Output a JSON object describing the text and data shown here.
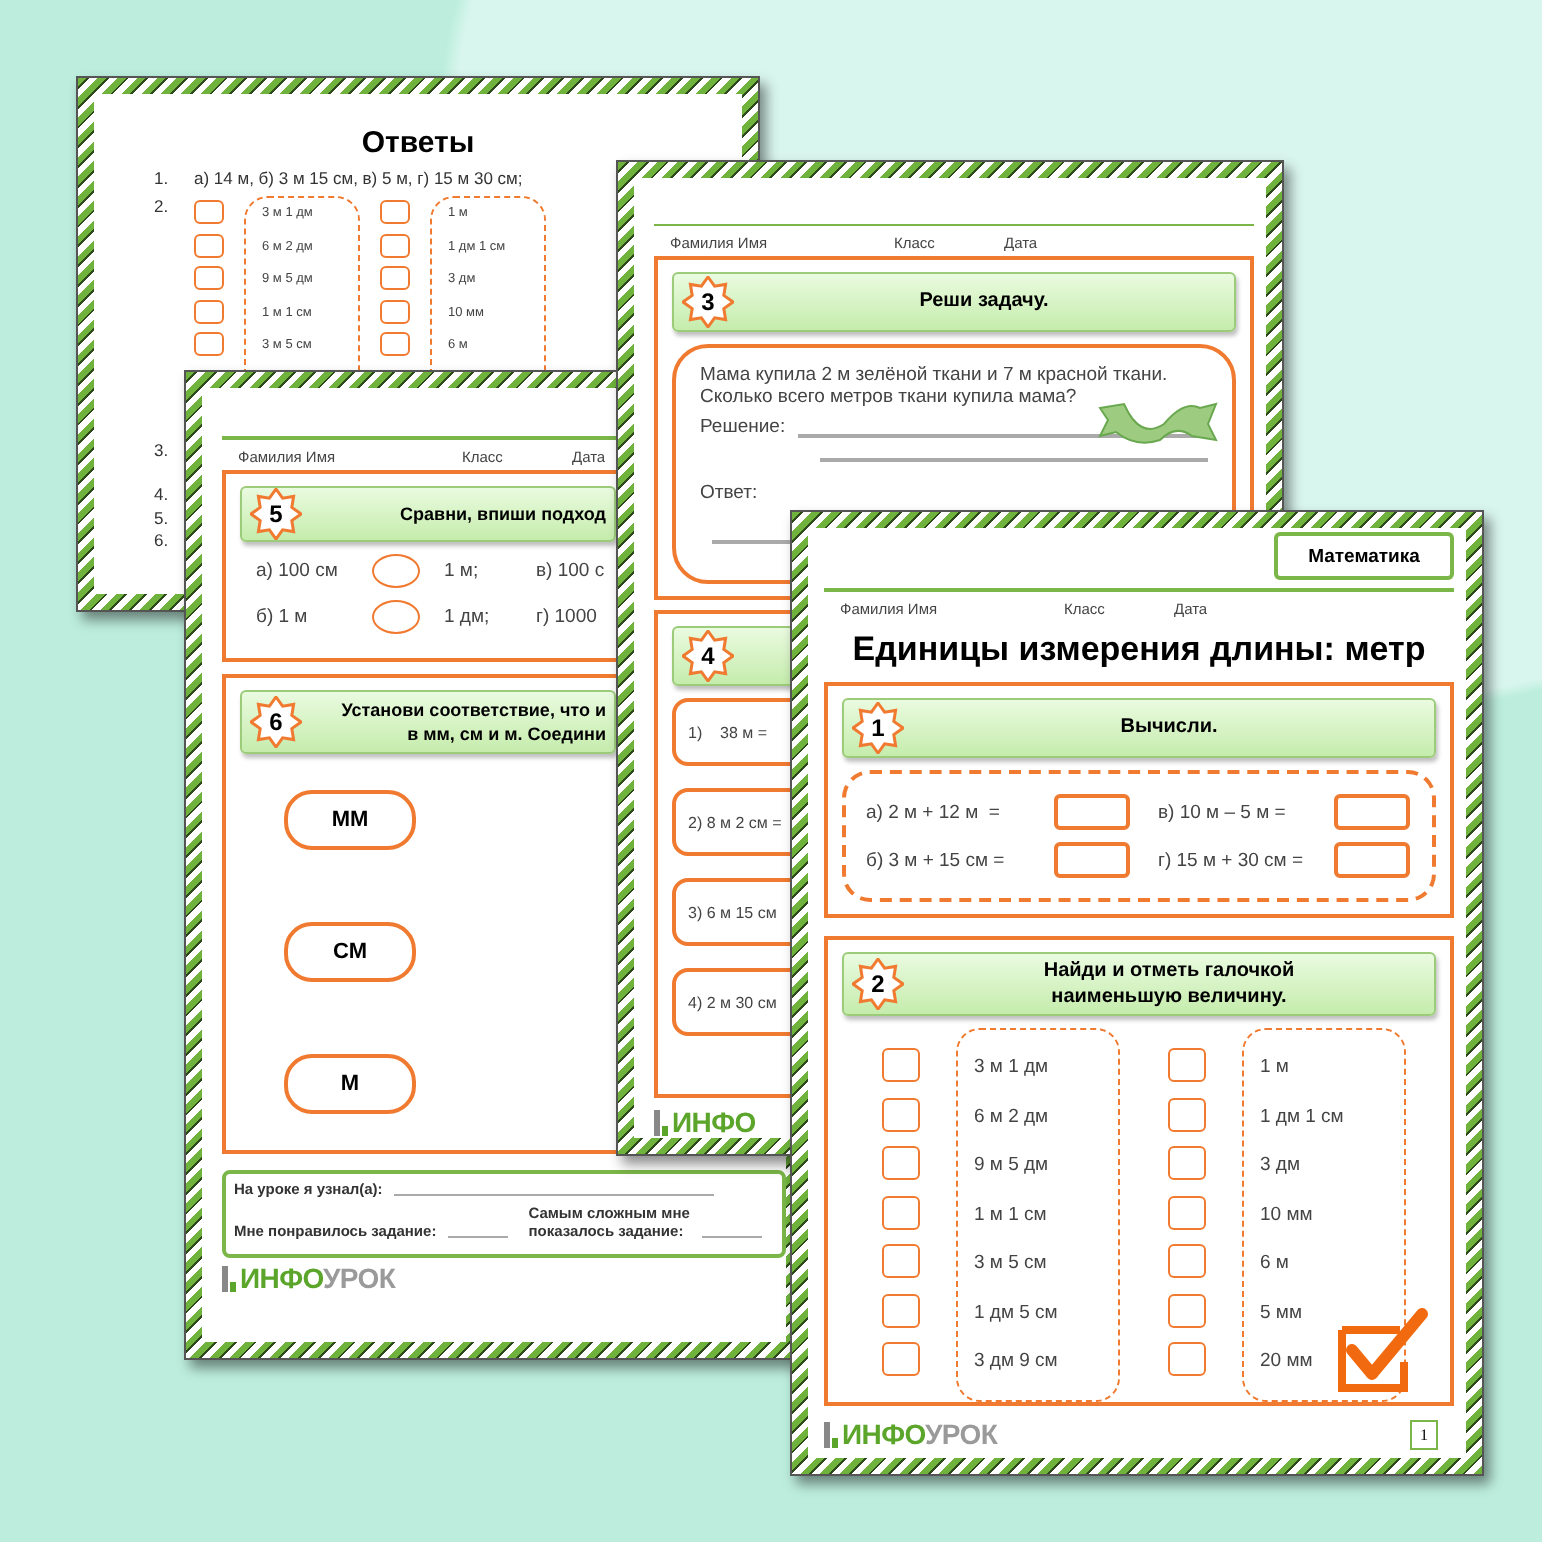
{
  "answers_page": {
    "title": "Ответы",
    "items": [
      {
        "kind": "text",
        "number": "1.",
        "text": "а) 14 м, б) 3 м 15 см, в) 5 м, г) 15 м 30 см;"
      },
      {
        "kind": "choice",
        "number": "2.",
        "lists": [
          [
            {
              "text": "3 м 1 дм",
              "checked": false
            },
            {
              "text": "6 м 2 дм",
              "checked": false
            },
            {
              "text": "9 м 5 дм",
              "checked": false
            },
            {
              "text": "1 м 1 см",
              "checked": false
            },
            {
              "text": "3 м 5 см",
              "checked": false
            }
          ],
          [
            {
              "text": "1 м",
              "checked": false
            },
            {
              "text": "1 дм 1 см",
              "checked": false
            },
            {
              "text": "3 дм",
              "checked": false
            },
            {
              "text": "10 мм",
              "checked": false
            },
            {
              "text": "6 м",
              "checked": false
            }
          ]
        ]
      },
      {
        "kind": "blank",
        "number": "3."
      },
      {
        "kind": "blank",
        "number": "4."
      },
      {
        "kind": "blank",
        "number": "5."
      },
      {
        "kind": "blank",
        "number": "6."
      }
    ]
  },
  "compare_sheet": {
    "fields": [
      "Фамилия Имя",
      "Класс",
      "Дата"
    ],
    "task_5": {
      "number": "5",
      "title": "Сравни, впиши подход",
      "rows": [
        [
          "а) 100 см",
          "1 м;",
          "в) 100 с"
        ],
        [
          "б) 1 м",
          "1 дм;",
          "г) 1000"
        ]
      ]
    },
    "task_6": {
      "number": "6",
      "title": "Установи соответствие, что и\nв мм, см и м. Соедини",
      "units": [
        "ММ",
        "СМ",
        "М"
      ]
    },
    "reflection": {
      "learned": "На уроке я узнал(а):",
      "liked": "Мне понравилось задание:",
      "hardest": "Самым сложным мне\nпоказалось задание:"
    },
    "logo": {
      "accent": "ИНФО",
      "rest": "УРОК"
    }
  },
  "problem_sheet": {
    "fields": [
      "Фамилия Имя",
      "Класс",
      "Дата"
    ],
    "task_3": {
      "number": "3",
      "title": "Реши задачу.",
      "problem": "Мама купила 2 м зелёной ткани и 7 м красной ткани.\nСколько всего метров ткани купила мама?",
      "solution_label": "Решение:",
      "answer_label": "Ответ:"
    },
    "task_4": {
      "number": "4",
      "items": [
        "1)    38 м =",
        "2) 8 м 2 см =",
        "3) 6 м 15 см",
        "4) 2 м 30 см"
      ]
    },
    "logo": {
      "accent": "ИНФО"
    }
  },
  "main_sheet": {
    "subject": "Математика",
    "fields": [
      "Фамилия Имя",
      "Класс",
      "Дата"
    ],
    "title": "Единицы измерения длины: метр",
    "task_1": {
      "number": "1",
      "title": "Вычисли.",
      "expressions": [
        "а) 2 м + 12 м  =",
        "в) 10 м – 5 м =",
        "б) 3 м + 15 см =",
        "г) 15 м + 30 см ="
      ]
    },
    "task_2": {
      "number": "2",
      "title": "Найди и отметь галочкой\nнаименьшую величину.",
      "lists": [
        [
          {
            "text": "3 м 1 дм",
            "checked": false
          },
          {
            "text": "6 м 2 дм",
            "checked": false
          },
          {
            "text": "9 м 5 дм",
            "checked": false
          },
          {
            "text": "1 м 1 см",
            "checked": false
          },
          {
            "text": "3 м 5 см",
            "checked": false
          },
          {
            "text": "1 дм 5 см",
            "checked": false
          },
          {
            "text": "3 дм 9 см",
            "checked": false
          }
        ],
        [
          {
            "text": "1 м",
            "checked": false
          },
          {
            "text": "1 дм 1 см",
            "checked": false
          },
          {
            "text": "3 дм",
            "checked": false
          },
          {
            "text": "10 мм",
            "checked": false
          },
          {
            "text": "6 м",
            "checked": false
          },
          {
            "text": "5 мм",
            "checked": false
          },
          {
            "text": "20 мм",
            "checked": false
          }
        ]
      ]
    },
    "logo": {
      "accent": "ИНФО",
      "rest": "УРОК"
    },
    "page_number": "1"
  }
}
